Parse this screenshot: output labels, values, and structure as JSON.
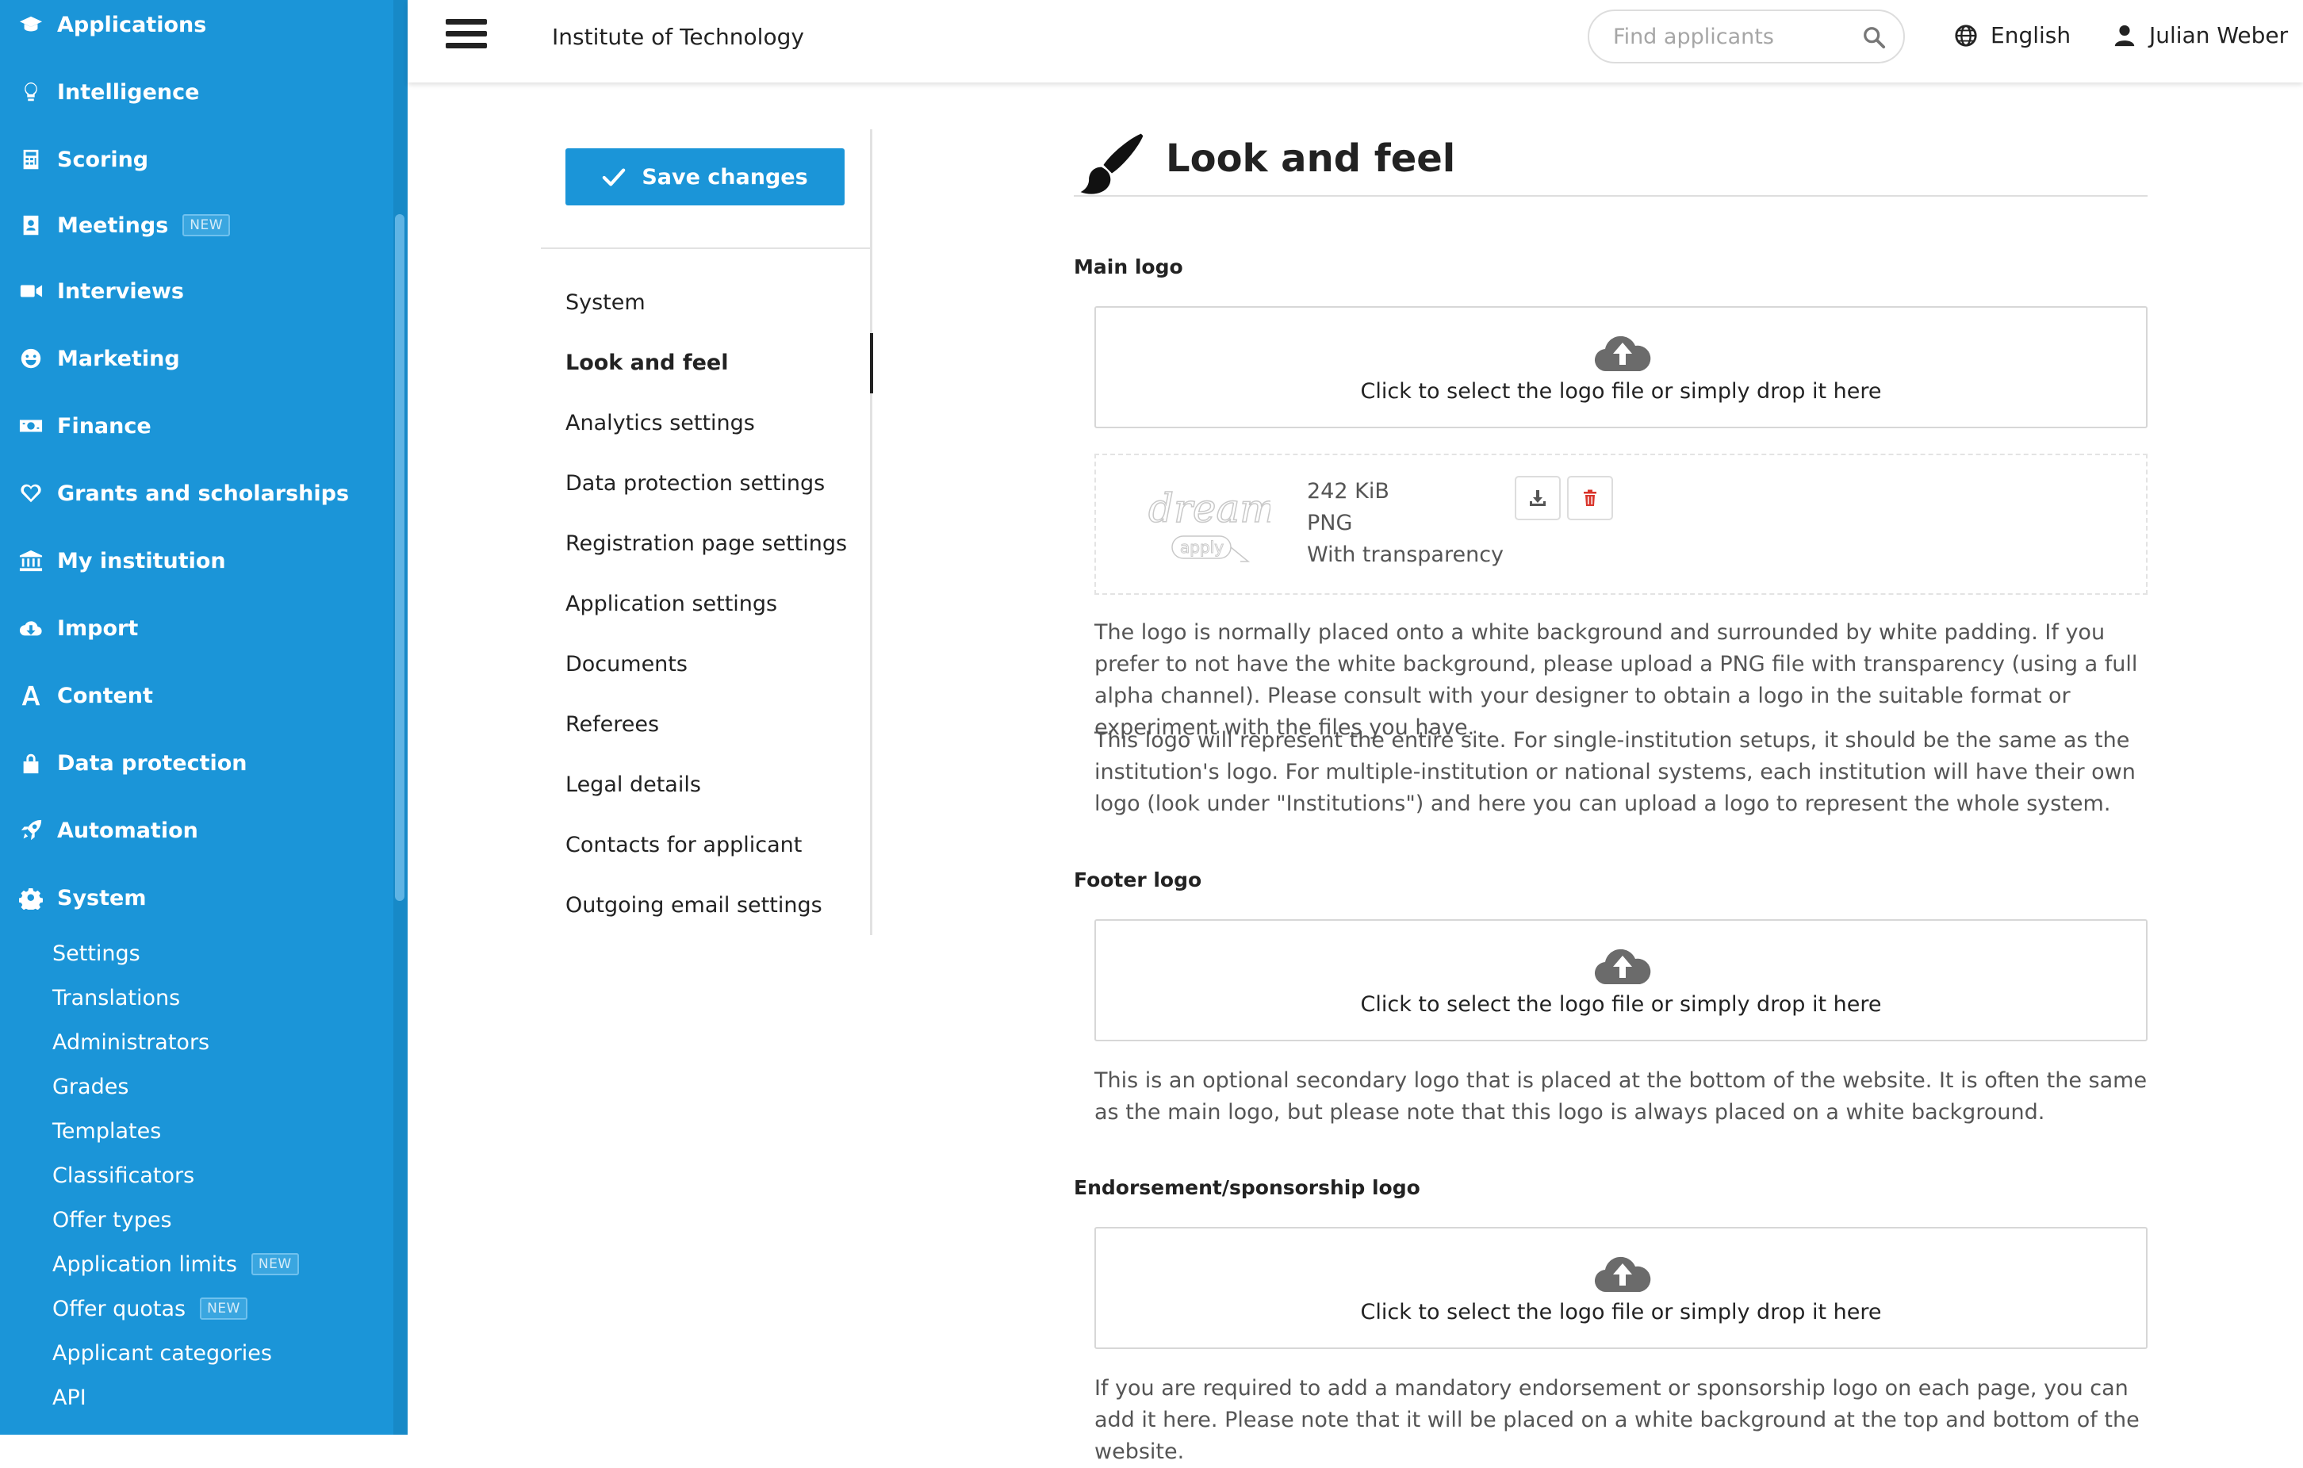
{
  "sidebar": {
    "items": [
      {
        "label": "Applications",
        "icon": "graduation-cap-icon"
      },
      {
        "label": "Intelligence",
        "icon": "lightbulb-icon"
      },
      {
        "label": "Scoring",
        "icon": "calculator-icon"
      },
      {
        "label": "Meetings",
        "icon": "address-book-icon",
        "badge": "NEW"
      },
      {
        "label": "Interviews",
        "icon": "video-camera-icon"
      },
      {
        "label": "Marketing",
        "icon": "smile-icon"
      },
      {
        "label": "Finance",
        "icon": "money-bill-icon"
      },
      {
        "label": "Grants and scholarships",
        "icon": "heart-icon"
      },
      {
        "label": "My institution",
        "icon": "institution-icon"
      },
      {
        "label": "Import",
        "icon": "cloud-download-icon"
      },
      {
        "label": "Content",
        "icon": "font-icon"
      },
      {
        "label": "Data protection",
        "icon": "lock-icon"
      },
      {
        "label": "Automation",
        "icon": "rocket-icon"
      },
      {
        "label": "System",
        "icon": "gear-icon"
      }
    ],
    "system_sub": [
      {
        "label": "Settings"
      },
      {
        "label": "Translations"
      },
      {
        "label": "Administrators"
      },
      {
        "label": "Grades"
      },
      {
        "label": "Templates"
      },
      {
        "label": "Classificators"
      },
      {
        "label": "Offer types"
      },
      {
        "label": "Application limits",
        "badge": "NEW"
      },
      {
        "label": "Offer quotas",
        "badge": "NEW"
      },
      {
        "label": "Applicant categories"
      },
      {
        "label": "API"
      }
    ]
  },
  "topbar": {
    "org_name": "Institute of Technology",
    "search_placeholder": "Find applicants",
    "language": "English",
    "user_name": "Julian Weber"
  },
  "settings_nav": {
    "save_label": "Save changes",
    "active_index": 1,
    "links": [
      "System",
      "Look and feel",
      "Analytics settings",
      "Data protection settings",
      "Registration page settings",
      "Application settings",
      "Documents",
      "Referees",
      "Legal details",
      "Contacts for applicant",
      "Outgoing email settings"
    ]
  },
  "main": {
    "title": "Look and feel",
    "upload_prompt": "Click to select the logo file or simply drop it here",
    "main_logo": {
      "label": "Main logo",
      "file": {
        "size": "242 KiB",
        "format": "PNG",
        "transparency": "With transparency",
        "thumb_text_1": "dream",
        "thumb_text_2": "apply"
      },
      "help_1": "The logo is normally placed onto a white background and surrounded by white padding. If you prefer to not have the white background, please upload a PNG file with transparency (using a full alpha channel). Please consult with your designer to obtain a logo in the suitable format or experiment with the files you have.",
      "help_2": "This logo will represent the entire site. For single-institution setups, it should be the same as the institution's logo. For multiple-institution or national systems, each institution will have their own logo (look under \"Institutions\") and here you can upload a logo to represent the whole system."
    },
    "footer_logo": {
      "label": "Footer logo",
      "help": "This is an optional secondary logo that is placed at the bottom of the website. It is often the same as the main logo, but please note that this logo is always placed on a white background."
    },
    "endorsement_logo": {
      "label": "Endorsement/sponsorship logo",
      "help": "If you are required to add a mandatory endorsement or sponsorship logo on each page, you can add it here. Please note that it will be placed on a white background at the top and bottom of the website."
    }
  },
  "colors": {
    "sidebar_bg": "#1b95d8",
    "accent": "#1b95d8",
    "danger": "#d9342b"
  }
}
